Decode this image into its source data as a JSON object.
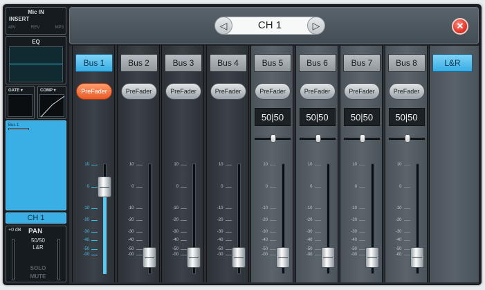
{
  "left": {
    "input_label": "Mic IN",
    "insert_label": "INSERT",
    "insert_items": [
      "48V",
      "REV",
      "MP3"
    ],
    "eq_label": "EQ",
    "gate_label": "GATE",
    "comp_label": "COMP",
    "send_label": "Bus 1",
    "channel_name": "CH 1",
    "gain_db": "+0 dB",
    "pan_label": "PAN",
    "pan_value": "50/50",
    "pan_route": "L&R",
    "solo_label": "SOLO",
    "mute_label": "MUTE"
  },
  "header": {
    "channel_title": "CH 1",
    "prev_icon": "chevron-left-icon",
    "next_icon": "chevron-right-icon",
    "close_icon": "close-x-icon"
  },
  "scale_ticks": [
    "10",
    "0",
    "-10",
    "-20",
    "-30",
    "-40",
    "-50",
    "-00"
  ],
  "buses": [
    {
      "label": "Bus 1",
      "active": true,
      "prefader_label": "PreFader",
      "prefader_active": true,
      "pan": null,
      "fader_db": 0
    },
    {
      "label": "Bus 2",
      "active": false,
      "prefader_label": "PreFader",
      "prefader_active": false,
      "pan": null,
      "fader_db": "-00"
    },
    {
      "label": "Bus 3",
      "active": false,
      "prefader_label": "PreFader",
      "prefader_active": false,
      "pan": null,
      "fader_db": "-00"
    },
    {
      "label": "Bus 4",
      "active": false,
      "prefader_label": "PreFader",
      "prefader_active": false,
      "pan": null,
      "fader_db": "-00"
    },
    {
      "label": "Bus 5",
      "active": false,
      "prefader_label": "PreFader",
      "prefader_active": false,
      "pan": "50|50",
      "fader_db": "-00"
    },
    {
      "label": "Bus 6",
      "active": false,
      "prefader_label": "PreFader",
      "prefader_active": false,
      "pan": "50|50",
      "fader_db": "-00"
    },
    {
      "label": "Bus 7",
      "active": false,
      "prefader_label": "PreFader",
      "prefader_active": false,
      "pan": "50|50",
      "fader_db": "-00"
    },
    {
      "label": "Bus 8",
      "active": false,
      "prefader_label": "PreFader",
      "prefader_active": false,
      "pan": "50|50",
      "fader_db": "-00"
    }
  ],
  "main_output": {
    "label": "L&R",
    "active": true
  },
  "colors": {
    "accent": "#3aafe6",
    "prefader_active": "#ea5a25",
    "close": "#e2382a"
  }
}
